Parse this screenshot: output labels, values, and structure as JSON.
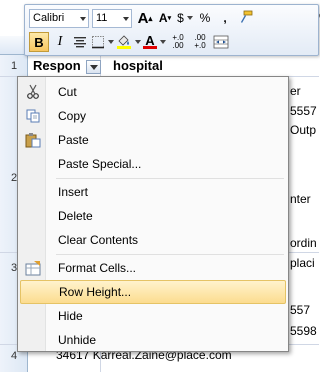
{
  "toolbar": {
    "font_name": "Calibri",
    "font_size": "11",
    "grow_font": "A",
    "shrink_font": "A",
    "currency": "$",
    "percent": "%",
    "comma": ",",
    "bold": "B",
    "italic": "I",
    "font_color_letter": "A",
    "increase_decimal": "+.0\n.00",
    "decrease_decimal": ".00\n+.0",
    "increase_decimal_label": "⁺.0",
    "decrease_decimal_label": ".00"
  },
  "sheet": {
    "a1": "Respon",
    "b1": "hospital",
    "row_headers": [
      "1",
      "2",
      "3",
      "4"
    ],
    "top_right_fragment": "espo",
    "fragments": [
      "er",
      "5557",
      "Outp",
      "nter",
      "ordin",
      "placi",
      "557",
      "5598"
    ],
    "row4_text": "34617 Karreal.Zaine@place.com"
  },
  "menu": {
    "items": [
      {
        "label": "Cut",
        "icon": "scissors-icon"
      },
      {
        "label": "Copy",
        "icon": "copy-icon"
      },
      {
        "label": "Paste",
        "icon": "paste-icon"
      },
      {
        "label": "Paste Special...",
        "icon": ""
      },
      {
        "label": "Insert",
        "icon": ""
      },
      {
        "label": "Delete",
        "icon": ""
      },
      {
        "label": "Clear Contents",
        "icon": ""
      },
      {
        "label": "Format Cells...",
        "icon": "format-cells-icon"
      },
      {
        "label": "Row Height...",
        "icon": ""
      },
      {
        "label": "Hide",
        "icon": ""
      },
      {
        "label": "Unhide",
        "icon": ""
      }
    ]
  },
  "colors": {
    "menu_highlight": "#fcdc8f",
    "toolbar_border": "#9db3cf",
    "font_color_bar": "#e00000",
    "fill_color_bar": "#ffff00"
  }
}
